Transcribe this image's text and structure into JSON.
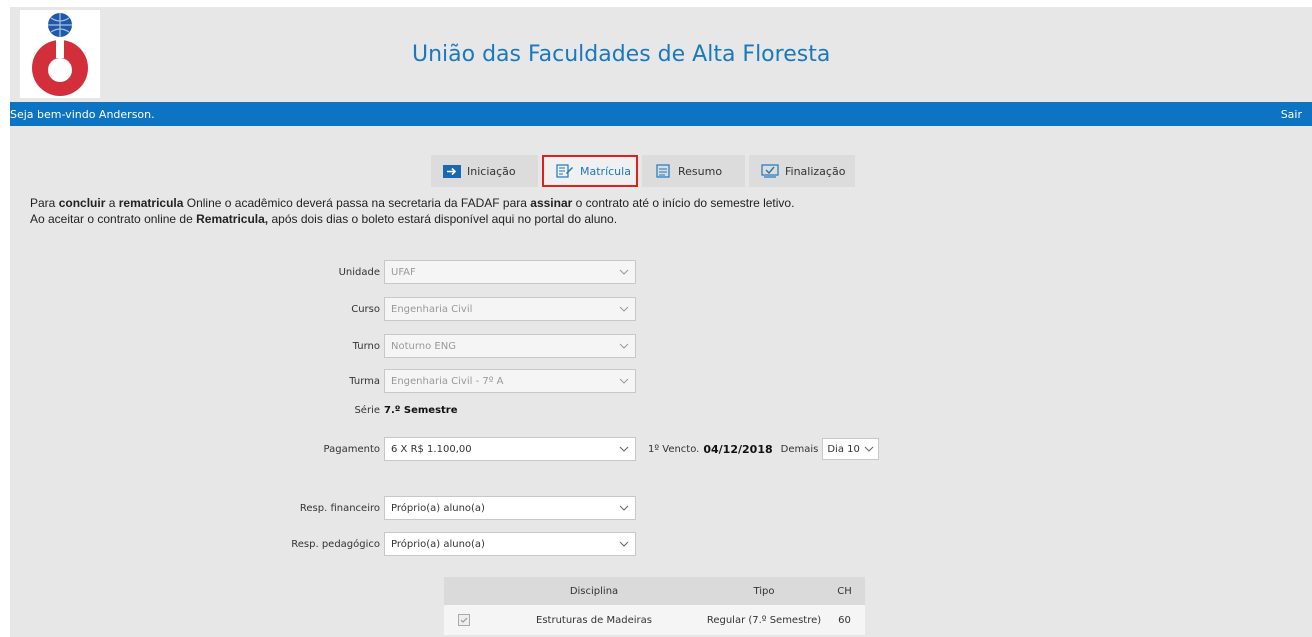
{
  "header": {
    "title": "União das Faculdades de Alta Floresta"
  },
  "topbar": {
    "welcome": "Seja bem-vindo Anderson.",
    "logout": "Sair"
  },
  "steps": [
    {
      "label": "Iniciação",
      "icon": "arrow-right-icon",
      "active": false
    },
    {
      "label": "Matrícula",
      "icon": "edit-document-icon",
      "active": true
    },
    {
      "label": "Resumo",
      "icon": "document-icon",
      "active": false
    },
    {
      "label": "Finalização",
      "icon": "monitor-check-icon",
      "active": false
    }
  ],
  "notice": {
    "line1_a": "Para ",
    "line1_b": "concluir",
    "line1_c": " a ",
    "line1_d": "rematricula",
    "line1_e": " Online o acadêmico deverá passa na secretaria da FADAF para ",
    "line1_f": "assinar",
    "line1_g": " o contrato até o início do semestre letivo.",
    "line2_a": "Ao aceitar o contrato online de ",
    "line2_b": "Rematricula,",
    "line2_c": " após dois dias o boleto estará disponível aqui no portal do aluno."
  },
  "form": {
    "unidade": {
      "label": "Unidade",
      "value": "UFAF"
    },
    "curso": {
      "label": "Curso",
      "value": "Engenharia Civil"
    },
    "turno": {
      "label": "Turno",
      "value": "Noturno ENG"
    },
    "turma": {
      "label": "Turma",
      "value": "Engenharia Civil - 7º A"
    },
    "serie": {
      "label": "Série",
      "value": "7.º Semestre"
    },
    "pagamento": {
      "label": "Pagamento",
      "value": "6 X R$ 1.100,00"
    },
    "vencto_label": "1º Vencto.",
    "vencto_value": "04/12/2018",
    "demais_label": "Demais",
    "demais_value": "Dia 10",
    "resp_fin": {
      "label": "Resp. financeiro",
      "value": "Próprio(a) aluno(a)"
    },
    "resp_ped": {
      "label": "Resp. pedagógico",
      "value": "Próprio(a) aluno(a)"
    }
  },
  "table": {
    "headers": [
      "Disciplina",
      "Tipo",
      "CH"
    ],
    "rows": [
      {
        "disciplina": "Estruturas de Madeiras",
        "tipo": "Regular (7.º Semestre)",
        "ch": "60"
      }
    ]
  },
  "colors": {
    "brand_blue": "#0c74c3",
    "title_blue": "#1a78bf",
    "logo_red": "#d32f3a",
    "active_border": "#e02020"
  }
}
